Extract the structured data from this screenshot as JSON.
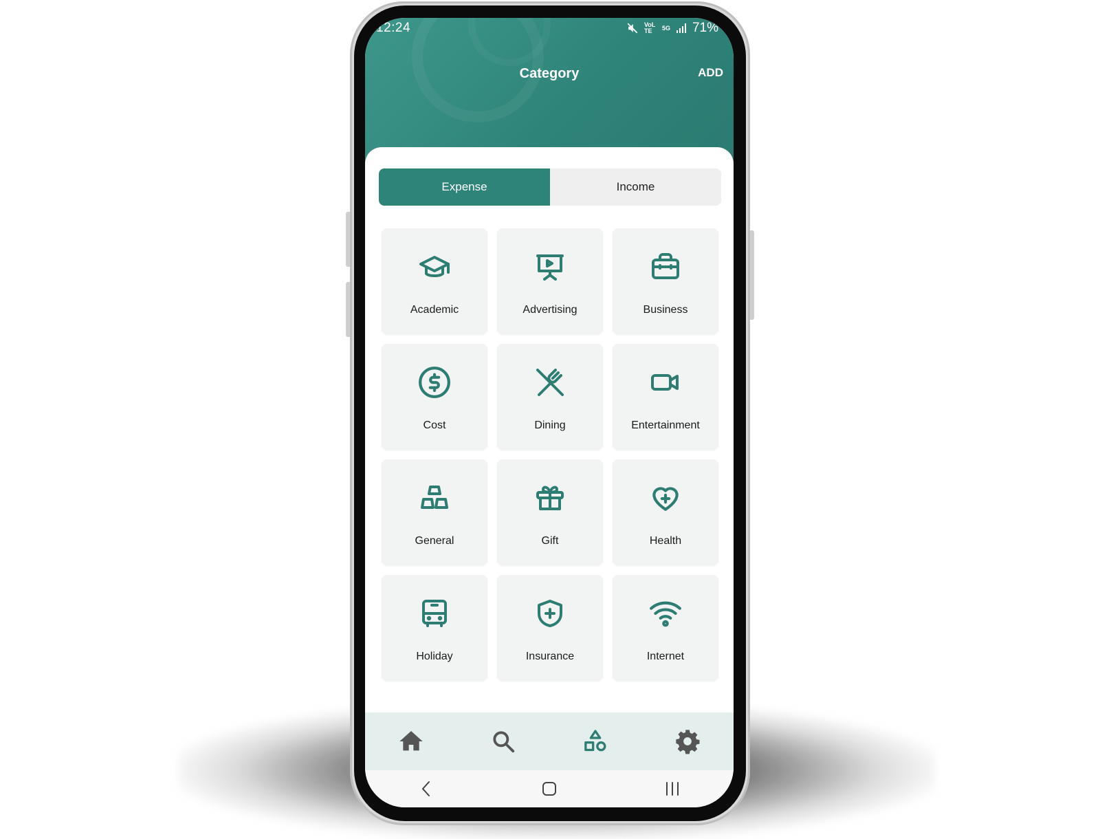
{
  "status_bar": {
    "time": "12:24",
    "lte_label": "VoLTE",
    "net_label": "5G",
    "battery": "71%"
  },
  "header": {
    "title": "Category",
    "add_label": "ADD"
  },
  "tabs": [
    {
      "label": "Expense",
      "active": true
    },
    {
      "label": "Income",
      "active": false
    }
  ],
  "categories": [
    {
      "label": "Academic",
      "icon": "graduation-cap-icon"
    },
    {
      "label": "Advertising",
      "icon": "presentation-icon"
    },
    {
      "label": "Business",
      "icon": "briefcase-icon"
    },
    {
      "label": "Cost",
      "icon": "dollar-circle-icon"
    },
    {
      "label": "Dining",
      "icon": "fork-knife-icon"
    },
    {
      "label": "Entertainment",
      "icon": "video-camera-icon"
    },
    {
      "label": "General",
      "icon": "blocks-icon"
    },
    {
      "label": "Gift",
      "icon": "gift-icon"
    },
    {
      "label": "Health",
      "icon": "heart-plus-icon"
    },
    {
      "label": "Holiday",
      "icon": "bus-icon"
    },
    {
      "label": "Insurance",
      "icon": "shield-plus-icon"
    },
    {
      "label": "Internet",
      "icon": "wifi-icon"
    }
  ],
  "bottom_nav": [
    "home-icon",
    "search-icon",
    "shapes-icon",
    "settings-icon"
  ],
  "colors": {
    "primary": "#2e8479",
    "icon": "#2e7d72",
    "nav_bg": "#e4efed",
    "card_bg": "#f2f3f3"
  }
}
